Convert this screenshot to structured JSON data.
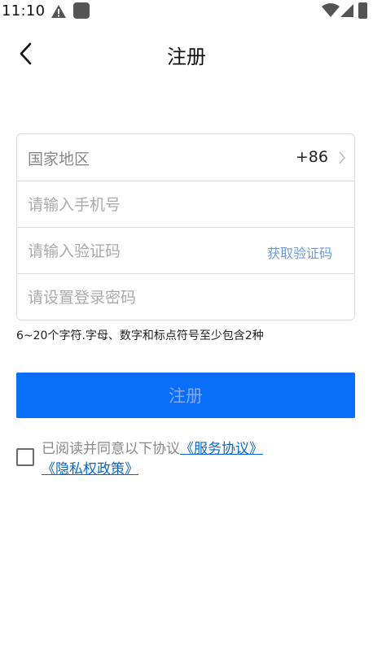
{
  "status_bar": {
    "time": "11:10",
    "icons": [
      "alert-icon",
      "app-icon",
      "wifi-icon",
      "signal-icon",
      "battery-icon"
    ]
  },
  "header": {
    "back_icon": "chevron-left-icon",
    "title": "注册"
  },
  "form": {
    "country_label": "国家地区",
    "country_code": "+86",
    "phone_placeholder": "请输入手机号",
    "code_placeholder": "请输入验证码",
    "get_code_label": "获取验证码",
    "password_placeholder": "请设置登录密码"
  },
  "hint": "6~20个字符.字母、数字和标点符号至少包含2种",
  "register_button": "注册",
  "agreement": {
    "prefix": "已阅读并同意以下协议",
    "service_link": "《服务协议》",
    "privacy_link": "《隐私权政策》",
    "checked": false
  },
  "colors": {
    "primary": "#0a6ef8",
    "link": "#0a67c8",
    "get_code": "#6d9ad6",
    "border": "#d9dbe4"
  }
}
